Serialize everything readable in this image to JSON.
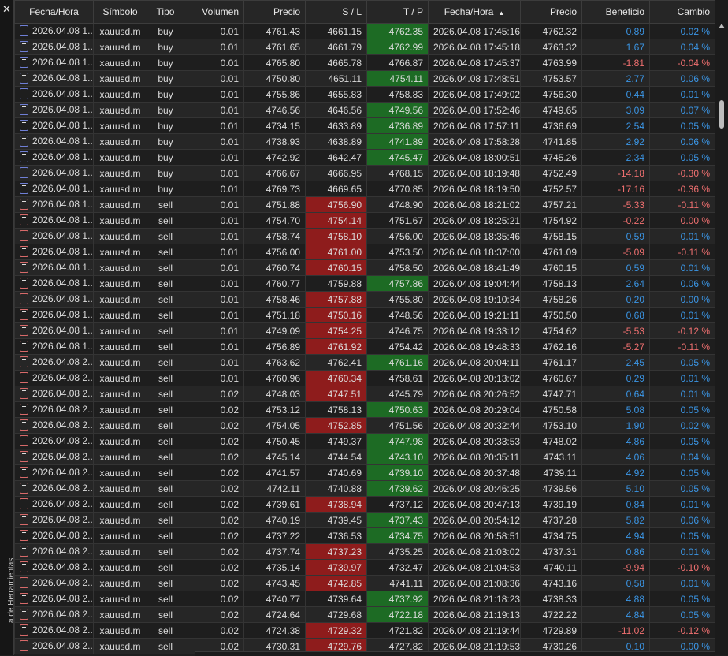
{
  "sidebar": {
    "label": "a de Herramientas"
  },
  "columns": [
    "Fecha/Hora",
    "Símbolo",
    "Tipo",
    "Volumen",
    "Precio",
    "S / L",
    "T / P",
    "Fecha/Hora",
    "Precio",
    "Beneficio",
    "Cambio"
  ],
  "rows": [
    {
      "open_time": "2026.04.08 1...",
      "symbol": "xauusd.m",
      "type": "buy",
      "volume": "0.01",
      "open_price": "4761.43",
      "sl": "4661.15",
      "tp": "4762.35",
      "close_time": "2026.04.08 17:45:16",
      "close_price": "4762.32",
      "profit": "0.89",
      "change": "0.02 %",
      "sl_color": "",
      "tp_color": "green",
      "neg": false
    },
    {
      "open_time": "2026.04.08 1...",
      "symbol": "xauusd.m",
      "type": "buy",
      "volume": "0.01",
      "open_price": "4761.65",
      "sl": "4661.79",
      "tp": "4762.99",
      "close_time": "2026.04.08 17:45:18",
      "close_price": "4763.32",
      "profit": "1.67",
      "change": "0.04 %",
      "sl_color": "",
      "tp_color": "green",
      "neg": false
    },
    {
      "open_time": "2026.04.08 1...",
      "symbol": "xauusd.m",
      "type": "buy",
      "volume": "0.01",
      "open_price": "4765.80",
      "sl": "4665.78",
      "tp": "4766.87",
      "close_time": "2026.04.08 17:45:37",
      "close_price": "4763.99",
      "profit": "-1.81",
      "change": "-0.04 %",
      "sl_color": "",
      "tp_color": "",
      "neg": true
    },
    {
      "open_time": "2026.04.08 1...",
      "symbol": "xauusd.m",
      "type": "buy",
      "volume": "0.01",
      "open_price": "4750.80",
      "sl": "4651.11",
      "tp": "4754.11",
      "close_time": "2026.04.08 17:48:51",
      "close_price": "4753.57",
      "profit": "2.77",
      "change": "0.06 %",
      "sl_color": "",
      "tp_color": "green",
      "neg": false
    },
    {
      "open_time": "2026.04.08 1...",
      "symbol": "xauusd.m",
      "type": "buy",
      "volume": "0.01",
      "open_price": "4755.86",
      "sl": "4655.83",
      "tp": "4758.83",
      "close_time": "2026.04.08 17:49:02",
      "close_price": "4756.30",
      "profit": "0.44",
      "change": "0.01 %",
      "sl_color": "",
      "tp_color": "",
      "neg": false
    },
    {
      "open_time": "2026.04.08 1...",
      "symbol": "xauusd.m",
      "type": "buy",
      "volume": "0.01",
      "open_price": "4746.56",
      "sl": "4646.56",
      "tp": "4749.56",
      "close_time": "2026.04.08 17:52:46",
      "close_price": "4749.65",
      "profit": "3.09",
      "change": "0.07 %",
      "sl_color": "",
      "tp_color": "green",
      "neg": false
    },
    {
      "open_time": "2026.04.08 1...",
      "symbol": "xauusd.m",
      "type": "buy",
      "volume": "0.01",
      "open_price": "4734.15",
      "sl": "4633.89",
      "tp": "4736.89",
      "close_time": "2026.04.08 17:57:11",
      "close_price": "4736.69",
      "profit": "2.54",
      "change": "0.05 %",
      "sl_color": "",
      "tp_color": "green",
      "neg": false
    },
    {
      "open_time": "2026.04.08 1...",
      "symbol": "xauusd.m",
      "type": "buy",
      "volume": "0.01",
      "open_price": "4738.93",
      "sl": "4638.89",
      "tp": "4741.89",
      "close_time": "2026.04.08 17:58:28",
      "close_price": "4741.85",
      "profit": "2.92",
      "change": "0.06 %",
      "sl_color": "",
      "tp_color": "green",
      "neg": false
    },
    {
      "open_time": "2026.04.08 1...",
      "symbol": "xauusd.m",
      "type": "buy",
      "volume": "0.01",
      "open_price": "4742.92",
      "sl": "4642.47",
      "tp": "4745.47",
      "close_time": "2026.04.08 18:00:51",
      "close_price": "4745.26",
      "profit": "2.34",
      "change": "0.05 %",
      "sl_color": "",
      "tp_color": "green",
      "neg": false
    },
    {
      "open_time": "2026.04.08 1...",
      "symbol": "xauusd.m",
      "type": "buy",
      "volume": "0.01",
      "open_price": "4766.67",
      "sl": "4666.95",
      "tp": "4768.15",
      "close_time": "2026.04.08 18:19:48",
      "close_price": "4752.49",
      "profit": "-14.18",
      "change": "-0.30 %",
      "sl_color": "",
      "tp_color": "",
      "neg": true
    },
    {
      "open_time": "2026.04.08 1...",
      "symbol": "xauusd.m",
      "type": "buy",
      "volume": "0.01",
      "open_price": "4769.73",
      "sl": "4669.65",
      "tp": "4770.85",
      "close_time": "2026.04.08 18:19:50",
      "close_price": "4752.57",
      "profit": "-17.16",
      "change": "-0.36 %",
      "sl_color": "",
      "tp_color": "",
      "neg": true
    },
    {
      "open_time": "2026.04.08 1...",
      "symbol": "xauusd.m",
      "type": "sell",
      "volume": "0.01",
      "open_price": "4751.88",
      "sl": "4756.90",
      "tp": "4748.90",
      "close_time": "2026.04.08 18:21:02",
      "close_price": "4757.21",
      "profit": "-5.33",
      "change": "-0.11 %",
      "sl_color": "red",
      "tp_color": "",
      "neg": true
    },
    {
      "open_time": "2026.04.08 1...",
      "symbol": "xauusd.m",
      "type": "sell",
      "volume": "0.01",
      "open_price": "4754.70",
      "sl": "4754.14",
      "tp": "4751.67",
      "close_time": "2026.04.08 18:25:21",
      "close_price": "4754.92",
      "profit": "-0.22",
      "change": "0.00 %",
      "sl_color": "red",
      "tp_color": "",
      "neg": true
    },
    {
      "open_time": "2026.04.08 1...",
      "symbol": "xauusd.m",
      "type": "sell",
      "volume": "0.01",
      "open_price": "4758.74",
      "sl": "4758.10",
      "tp": "4756.00",
      "close_time": "2026.04.08 18:35:46",
      "close_price": "4758.15",
      "profit": "0.59",
      "change": "0.01 %",
      "sl_color": "red",
      "tp_color": "",
      "neg": false
    },
    {
      "open_time": "2026.04.08 1...",
      "symbol": "xauusd.m",
      "type": "sell",
      "volume": "0.01",
      "open_price": "4756.00",
      "sl": "4761.00",
      "tp": "4753.50",
      "close_time": "2026.04.08 18:37:00",
      "close_price": "4761.09",
      "profit": "-5.09",
      "change": "-0.11 %",
      "sl_color": "red",
      "tp_color": "",
      "neg": true
    },
    {
      "open_time": "2026.04.08 1...",
      "symbol": "xauusd.m",
      "type": "sell",
      "volume": "0.01",
      "open_price": "4760.74",
      "sl": "4760.15",
      "tp": "4758.50",
      "close_time": "2026.04.08 18:41:49",
      "close_price": "4760.15",
      "profit": "0.59",
      "change": "0.01 %",
      "sl_color": "red",
      "tp_color": "",
      "neg": false
    },
    {
      "open_time": "2026.04.08 1...",
      "symbol": "xauusd.m",
      "type": "sell",
      "volume": "0.01",
      "open_price": "4760.77",
      "sl": "4759.88",
      "tp": "4757.86",
      "close_time": "2026.04.08 19:04:44",
      "close_price": "4758.13",
      "profit": "2.64",
      "change": "0.06 %",
      "sl_color": "",
      "tp_color": "green",
      "neg": false
    },
    {
      "open_time": "2026.04.08 1...",
      "symbol": "xauusd.m",
      "type": "sell",
      "volume": "0.01",
      "open_price": "4758.46",
      "sl": "4757.88",
      "tp": "4755.80",
      "close_time": "2026.04.08 19:10:34",
      "close_price": "4758.26",
      "profit": "0.20",
      "change": "0.00 %",
      "sl_color": "red",
      "tp_color": "",
      "neg": false
    },
    {
      "open_time": "2026.04.08 1...",
      "symbol": "xauusd.m",
      "type": "sell",
      "volume": "0.01",
      "open_price": "4751.18",
      "sl": "4750.16",
      "tp": "4748.56",
      "close_time": "2026.04.08 19:21:11",
      "close_price": "4750.50",
      "profit": "0.68",
      "change": "0.01 %",
      "sl_color": "red",
      "tp_color": "",
      "neg": false
    },
    {
      "open_time": "2026.04.08 1...",
      "symbol": "xauusd.m",
      "type": "sell",
      "volume": "0.01",
      "open_price": "4749.09",
      "sl": "4754.25",
      "tp": "4746.75",
      "close_time": "2026.04.08 19:33:12",
      "close_price": "4754.62",
      "profit": "-5.53",
      "change": "-0.12 %",
      "sl_color": "red",
      "tp_color": "",
      "neg": true
    },
    {
      "open_time": "2026.04.08 1...",
      "symbol": "xauusd.m",
      "type": "sell",
      "volume": "0.01",
      "open_price": "4756.89",
      "sl": "4761.92",
      "tp": "4754.42",
      "close_time": "2026.04.08 19:48:33",
      "close_price": "4762.16",
      "profit": "-5.27",
      "change": "-0.11 %",
      "sl_color": "red",
      "tp_color": "",
      "neg": true
    },
    {
      "open_time": "2026.04.08 2...",
      "symbol": "xauusd.m",
      "type": "sell",
      "volume": "0.01",
      "open_price": "4763.62",
      "sl": "4762.41",
      "tp": "4761.16",
      "close_time": "2026.04.08 20:04:11",
      "close_price": "4761.17",
      "profit": "2.45",
      "change": "0.05 %",
      "sl_color": "",
      "tp_color": "green",
      "neg": false
    },
    {
      "open_time": "2026.04.08 2...",
      "symbol": "xauusd.m",
      "type": "sell",
      "volume": "0.01",
      "open_price": "4760.96",
      "sl": "4760.34",
      "tp": "4758.61",
      "close_time": "2026.04.08 20:13:02",
      "close_price": "4760.67",
      "profit": "0.29",
      "change": "0.01 %",
      "sl_color": "red",
      "tp_color": "",
      "neg": false
    },
    {
      "open_time": "2026.04.08 2...",
      "symbol": "xauusd.m",
      "type": "sell",
      "volume": "0.02",
      "open_price": "4748.03",
      "sl": "4747.51",
      "tp": "4745.79",
      "close_time": "2026.04.08 20:26:52",
      "close_price": "4747.71",
      "profit": "0.64",
      "change": "0.01 %",
      "sl_color": "red",
      "tp_color": "",
      "neg": false
    },
    {
      "open_time": "2026.04.08 2...",
      "symbol": "xauusd.m",
      "type": "sell",
      "volume": "0.02",
      "open_price": "4753.12",
      "sl": "4758.13",
      "tp": "4750.63",
      "close_time": "2026.04.08 20:29:04",
      "close_price": "4750.58",
      "profit": "5.08",
      "change": "0.05 %",
      "sl_color": "",
      "tp_color": "green",
      "neg": false
    },
    {
      "open_time": "2026.04.08 2...",
      "symbol": "xauusd.m",
      "type": "sell",
      "volume": "0.02",
      "open_price": "4754.05",
      "sl": "4752.85",
      "tp": "4751.56",
      "close_time": "2026.04.08 20:32:44",
      "close_price": "4753.10",
      "profit": "1.90",
      "change": "0.02 %",
      "sl_color": "red",
      "tp_color": "",
      "neg": false
    },
    {
      "open_time": "2026.04.08 2...",
      "symbol": "xauusd.m",
      "type": "sell",
      "volume": "0.02",
      "open_price": "4750.45",
      "sl": "4749.37",
      "tp": "4747.98",
      "close_time": "2026.04.08 20:33:53",
      "close_price": "4748.02",
      "profit": "4.86",
      "change": "0.05 %",
      "sl_color": "",
      "tp_color": "green",
      "neg": false
    },
    {
      "open_time": "2026.04.08 2...",
      "symbol": "xauusd.m",
      "type": "sell",
      "volume": "0.02",
      "open_price": "4745.14",
      "sl": "4744.54",
      "tp": "4743.10",
      "close_time": "2026.04.08 20:35:11",
      "close_price": "4743.11",
      "profit": "4.06",
      "change": "0.04 %",
      "sl_color": "",
      "tp_color": "green",
      "neg": false
    },
    {
      "open_time": "2026.04.08 2...",
      "symbol": "xauusd.m",
      "type": "sell",
      "volume": "0.02",
      "open_price": "4741.57",
      "sl": "4740.69",
      "tp": "4739.10",
      "close_time": "2026.04.08 20:37:48",
      "close_price": "4739.11",
      "profit": "4.92",
      "change": "0.05 %",
      "sl_color": "",
      "tp_color": "green",
      "neg": false
    },
    {
      "open_time": "2026.04.08 2...",
      "symbol": "xauusd.m",
      "type": "sell",
      "volume": "0.02",
      "open_price": "4742.11",
      "sl": "4740.88",
      "tp": "4739.62",
      "close_time": "2026.04.08 20:46:25",
      "close_price": "4739.56",
      "profit": "5.10",
      "change": "0.05 %",
      "sl_color": "",
      "tp_color": "green",
      "neg": false
    },
    {
      "open_time": "2026.04.08 2...",
      "symbol": "xauusd.m",
      "type": "sell",
      "volume": "0.02",
      "open_price": "4739.61",
      "sl": "4738.94",
      "tp": "4737.12",
      "close_time": "2026.04.08 20:47:13",
      "close_price": "4739.19",
      "profit": "0.84",
      "change": "0.01 %",
      "sl_color": "red",
      "tp_color": "",
      "neg": false
    },
    {
      "open_time": "2026.04.08 2...",
      "symbol": "xauusd.m",
      "type": "sell",
      "volume": "0.02",
      "open_price": "4740.19",
      "sl": "4739.45",
      "tp": "4737.43",
      "close_time": "2026.04.08 20:54:12",
      "close_price": "4737.28",
      "profit": "5.82",
      "change": "0.06 %",
      "sl_color": "",
      "tp_color": "green",
      "neg": false
    },
    {
      "open_time": "2026.04.08 2...",
      "symbol": "xauusd.m",
      "type": "sell",
      "volume": "0.02",
      "open_price": "4737.22",
      "sl": "4736.53",
      "tp": "4734.75",
      "close_time": "2026.04.08 20:58:51",
      "close_price": "4734.75",
      "profit": "4.94",
      "change": "0.05 %",
      "sl_color": "",
      "tp_color": "green",
      "neg": false
    },
    {
      "open_time": "2026.04.08 2...",
      "symbol": "xauusd.m",
      "type": "sell",
      "volume": "0.02",
      "open_price": "4737.74",
      "sl": "4737.23",
      "tp": "4735.25",
      "close_time": "2026.04.08 21:03:02",
      "close_price": "4737.31",
      "profit": "0.86",
      "change": "0.01 %",
      "sl_color": "red",
      "tp_color": "",
      "neg": false
    },
    {
      "open_time": "2026.04.08 2...",
      "symbol": "xauusd.m",
      "type": "sell",
      "volume": "0.02",
      "open_price": "4735.14",
      "sl": "4739.97",
      "tp": "4732.47",
      "close_time": "2026.04.08 21:04:53",
      "close_price": "4740.11",
      "profit": "-9.94",
      "change": "-0.10 %",
      "sl_color": "red",
      "tp_color": "",
      "neg": true
    },
    {
      "open_time": "2026.04.08 2...",
      "symbol": "xauusd.m",
      "type": "sell",
      "volume": "0.02",
      "open_price": "4743.45",
      "sl": "4742.85",
      "tp": "4741.11",
      "close_time": "2026.04.08 21:08:36",
      "close_price": "4743.16",
      "profit": "0.58",
      "change": "0.01 %",
      "sl_color": "red",
      "tp_color": "",
      "neg": false
    },
    {
      "open_time": "2026.04.08 2...",
      "symbol": "xauusd.m",
      "type": "sell",
      "volume": "0.02",
      "open_price": "4740.77",
      "sl": "4739.64",
      "tp": "4737.92",
      "close_time": "2026.04.08 21:18:23",
      "close_price": "4738.33",
      "profit": "4.88",
      "change": "0.05 %",
      "sl_color": "",
      "tp_color": "green",
      "neg": false
    },
    {
      "open_time": "2026.04.08 2...",
      "symbol": "xauusd.m",
      "type": "sell",
      "volume": "0.02",
      "open_price": "4724.64",
      "sl": "4729.68",
      "tp": "4722.18",
      "close_time": "2026.04.08 21:19:13",
      "close_price": "4722.22",
      "profit": "4.84",
      "change": "0.05 %",
      "sl_color": "",
      "tp_color": "green",
      "neg": false
    },
    {
      "open_time": "2026.04.08 2...",
      "symbol": "xauusd.m",
      "type": "sell",
      "volume": "0.02",
      "open_price": "4724.38",
      "sl": "4729.32",
      "tp": "4721.82",
      "close_time": "2026.04.08 21:19:44",
      "close_price": "4729.89",
      "profit": "-11.02",
      "change": "-0.12 %",
      "sl_color": "red",
      "tp_color": "",
      "neg": true
    },
    {
      "open_time": "2026.04.08 2...",
      "symbol": "xauusd.m",
      "type": "sell",
      "volume": "0.02",
      "open_price": "4730.31",
      "sl": "4729.76",
      "tp": "4727.82",
      "close_time": "2026.04.08 21:19:53",
      "close_price": "4730.26",
      "profit": "0.10",
      "change": "0.00 %",
      "sl_color": "red",
      "tp_color": "",
      "neg": false
    }
  ]
}
